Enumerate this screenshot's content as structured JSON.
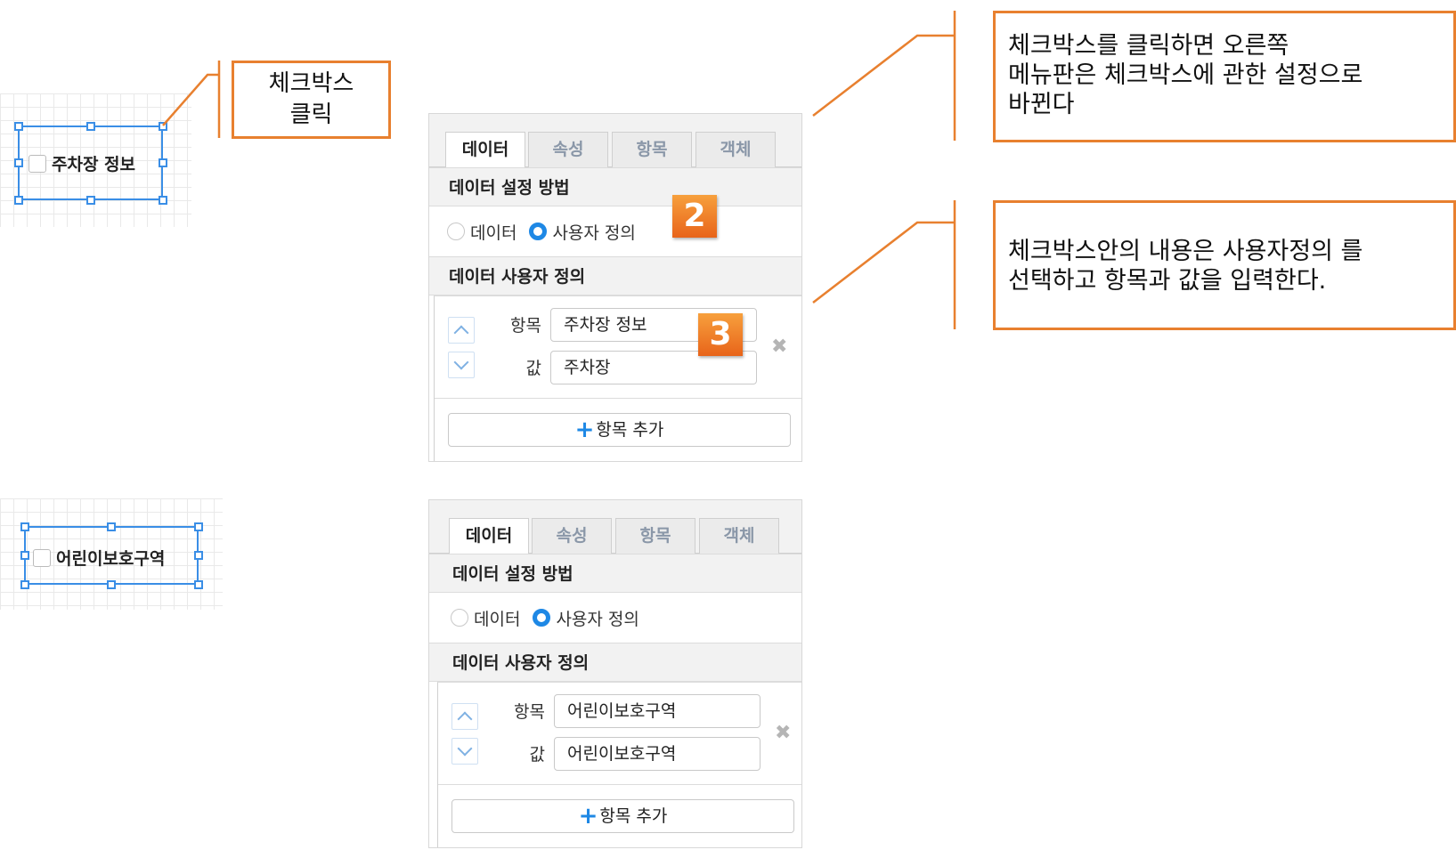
{
  "callouts": {
    "click_checkbox": "체크박스\n클릭",
    "menu_changes": "체크박스를 클릭하면 오른쪽\n메뉴판은 체크박스에 관한 설정으로\n바뀐다",
    "enter_content": "체크박스안의 내용은 사용자정의 를\n선택하고 항목과 값을 입력한다."
  },
  "accent_color": "#e8802f",
  "selection_color": "#3a8ee6",
  "examples": [
    {
      "widget_label": "주차장 정보",
      "panel": {
        "tabs": [
          "데이터",
          "속성",
          "항목",
          "객체"
        ],
        "active_tab": "데이터",
        "setting_method_heading": "데이터 설정 방법",
        "radio_options": [
          "데이터",
          "사용자 정의"
        ],
        "selected_radio": "사용자 정의",
        "custom_heading": "데이터 사용자 정의",
        "item_label": "항목",
        "item_value": "주차장 정보",
        "value_label": "값",
        "value_value": "주차장",
        "add_button": "항목 추가",
        "delete_icon": "close-icon"
      },
      "step_badges": [
        "2",
        "3"
      ]
    },
    {
      "widget_label": "어린이보호구역",
      "panel": {
        "tabs": [
          "데이터",
          "속성",
          "항목",
          "객체"
        ],
        "active_tab": "데이터",
        "setting_method_heading": "데이터 설정 방법",
        "radio_options": [
          "데이터",
          "사용자 정의"
        ],
        "selected_radio": "사용자 정의",
        "custom_heading": "데이터 사용자 정의",
        "item_label": "항목",
        "item_value": "어린이보호구역",
        "value_label": "값",
        "value_value": "어린이보호구역",
        "add_button": "항목 추가",
        "delete_icon": "close-icon"
      }
    }
  ]
}
